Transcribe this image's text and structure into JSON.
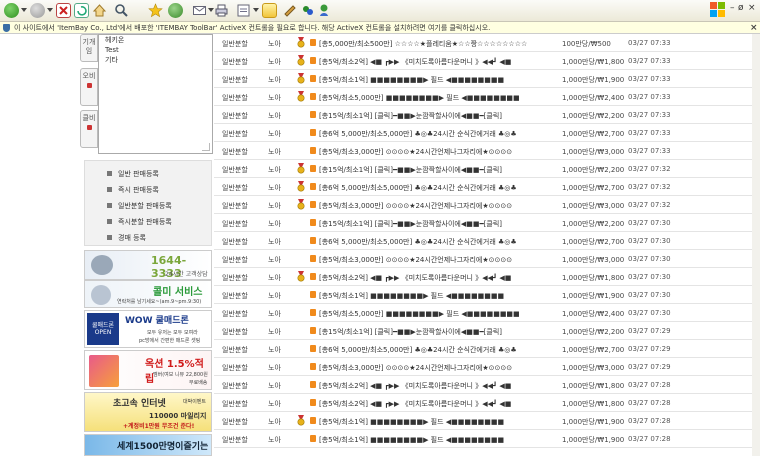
{
  "infobar": {
    "text": "이 사이트에서 'ItemBay Co., Ltd'에서 배포한 'ITEMBAY ToolBar' ActiveX 컨트롤을 필요로 합니다. 해당 ActiveX 컨트롤을 설치하려면 여기를 클릭하십시오.",
    "close": "×"
  },
  "window": {
    "minimize": "–",
    "restore": "ø",
    "close": "×"
  },
  "vtabs": [
    "기개임",
    "오비",
    "클비"
  ],
  "listbox_items": [
    "헤키온",
    "Test",
    "기타"
  ],
  "sale_menu": [
    "일반 판매등록",
    "즉시 판매등록",
    "일반분할 판매등록",
    "즉시분할 판매등록",
    "경매 등록"
  ],
  "banners": {
    "phone": {
      "number": "1644-3333",
      "sub": "24시간 고객상담"
    },
    "call": {
      "title": "콜미 서비스",
      "sub": "연락처를 남기세요~(am.9~pm.9:30)"
    },
    "wow": {
      "badge": "쿨매드론 OPEN",
      "title": "WOW 쿨매드론",
      "sub1": "모두 유저는 모두 모여라",
      "sub2": "pc방에서 간편한 매드론 셋팅"
    },
    "auction": {
      "title": "옥션 1.5%적립",
      "sub1": "멤버(여보 니뷰 22,800원",
      "sub2": "무료배송"
    },
    "internet": {
      "title": "초고속 인터넷",
      "tag": "대박이벤트",
      "sub1": "110000 마일리지",
      "sub2": "+계정비1만원 무조건 준다!"
    },
    "bottom": {
      "title": "세계1500만명이즐기는"
    }
  },
  "rows": [
    {
      "type": "일반분할",
      "server": "노아",
      "medal": true,
      "title": "[총5,000만/최소500만] ☆☆☆☆★플레티움★☆☆짱☆☆☆☆☆☆☆☆",
      "price": "100만당/₩500",
      "time": "03/27 07:33"
    },
    {
      "type": "일반분할",
      "server": "노아",
      "medal": true,
      "title": "[총5억/최소2억] ◀■ ┏▶▶ 《미치도록아름다운머니 》◀◀┛ ◀■",
      "price": "1,000만당/₩1,800",
      "time": "03/27 07:33"
    },
    {
      "type": "일반분할",
      "server": "노아",
      "medal": true,
      "title": "[총5억/최소1억] ■■■■■■■■▶ 필드 ◀■■■■■■■■",
      "price": "1,000만당/₩1,900",
      "time": "03/27 07:33"
    },
    {
      "type": "일반분할",
      "server": "노아",
      "medal": true,
      "title": "[총5억/최소5,000만] ■■■■■■■■▶ 필드 ◀■■■■■■■■",
      "price": "1,000만당/₩2,400",
      "time": "03/27 07:33"
    },
    {
      "type": "일반분할",
      "server": "노아",
      "medal": false,
      "title": "[총15억/최소1억] [클릭]━■■▶눈깜짝할사이에◀■■━[클릭]",
      "price": "1,000만당/₩2,200",
      "time": "03/27 07:33"
    },
    {
      "type": "일반분할",
      "server": "노아",
      "medal": false,
      "title": "[총6억 5,000만/최소5,000만] ♣◎♣24시간 순식간에거래 ♣◎♣",
      "price": "1,000만당/₩2,700",
      "time": "03/27 07:33"
    },
    {
      "type": "일반분할",
      "server": "노아",
      "medal": false,
      "title": "[총5억/최소3,000만] ⊙⊙⊙⊙★24시간언제나그자리에★⊙⊙⊙⊙",
      "price": "1,000만당/₩3,000",
      "time": "03/27 07:33"
    },
    {
      "type": "일반분할",
      "server": "노아",
      "medal": true,
      "title": "[총15억/최소1억] [클릭]━■■▶눈깜짝할사이에◀■■━[클릭]",
      "price": "1,000만당/₩2,200",
      "time": "03/27 07:32"
    },
    {
      "type": "일반분할",
      "server": "노아",
      "medal": true,
      "title": "[총6억 5,000만/최소5,000만] ♣◎♣24시간 순식간에거래 ♣◎♣",
      "price": "1,000만당/₩2,700",
      "time": "03/27 07:32"
    },
    {
      "type": "일반분할",
      "server": "노아",
      "medal": true,
      "title": "[총5억/최소3,000만] ⊙⊙⊙⊙★24시간언제나그자리에★⊙⊙⊙⊙",
      "price": "1,000만당/₩3,000",
      "time": "03/27 07:32"
    },
    {
      "type": "일반분할",
      "server": "노아",
      "medal": false,
      "title": "[총15억/최소1억] [클릭]━■■▶눈깜짝할사이에◀■■━[클릭]",
      "price": "1,000만당/₩2,200",
      "time": "03/27 07:30"
    },
    {
      "type": "일반분할",
      "server": "노아",
      "medal": false,
      "title": "[총6억 5,000만/최소5,000만] ♣◎♣24시간 순식간에거래 ♣◎♣",
      "price": "1,000만당/₩2,700",
      "time": "03/27 07:30"
    },
    {
      "type": "일반분할",
      "server": "노아",
      "medal": false,
      "title": "[총5억/최소3,000만] ⊙⊙⊙⊙★24시간언제나그자리에★⊙⊙⊙⊙",
      "price": "1,000만당/₩3,000",
      "time": "03/27 07:30"
    },
    {
      "type": "일반분할",
      "server": "노아",
      "medal": true,
      "title": "[총5억/최소2억] ◀■ ┏▶▶ 《미치도록아름다운머니 》◀◀┛ ◀■",
      "price": "1,000만당/₩1,800",
      "time": "03/27 07:30"
    },
    {
      "type": "일반분할",
      "server": "노아",
      "medal": false,
      "title": "[총5억/최소1억] ■■■■■■■■▶ 필드 ◀■■■■■■■■",
      "price": "1,000만당/₩1,900",
      "time": "03/27 07:30"
    },
    {
      "type": "일반분할",
      "server": "노아",
      "medal": false,
      "title": "[총5억/최소5,000만] ■■■■■■■■▶ 필드 ◀■■■■■■■■",
      "price": "1,000만당/₩2,400",
      "time": "03/27 07:30"
    },
    {
      "type": "일반분할",
      "server": "노아",
      "medal": false,
      "title": "[총15억/최소1억] [클릭]━■■▶눈깜짝할사이에◀■■━[클릭]",
      "price": "1,000만당/₩2,200",
      "time": "03/27 07:29"
    },
    {
      "type": "일반분할",
      "server": "노아",
      "medal": false,
      "title": "[총6억 5,000만/최소5,000만] ♣◎♣24시간 순식간에거래 ♣◎♣",
      "price": "1,000만당/₩2,700",
      "time": "03/27 07:29"
    },
    {
      "type": "일반분할",
      "server": "노아",
      "medal": false,
      "title": "[총5억/최소3,000만] ⊙⊙⊙⊙★24시간언제나그자리에★⊙⊙⊙⊙",
      "price": "1,000만당/₩3,000",
      "time": "03/27 07:29"
    },
    {
      "type": "일반분할",
      "server": "노아",
      "medal": false,
      "title": "[총5억/최소2억] ◀■ ┏▶▶ 《미치도록아름다운머니 》◀◀┛ ◀■",
      "price": "1,000만당/₩1,800",
      "time": "03/27 07:28"
    },
    {
      "type": "일반분할",
      "server": "노아",
      "medal": false,
      "title": "[총5억/최소2억] ◀■ ┏▶▶ 《미치도록아름다운머니 》◀◀┛ ◀■",
      "price": "1,000만당/₩1,800",
      "time": "03/27 07:28"
    },
    {
      "type": "일반분할",
      "server": "노아",
      "medal": true,
      "title": "[총5억/최소1억] ■■■■■■■■▶ 필드 ◀■■■■■■■■",
      "price": "1,000만당/₩1,900",
      "time": "03/27 07:28"
    },
    {
      "type": "일반분할",
      "server": "노아",
      "medal": false,
      "title": "[총5억/최소1억] ■■■■■■■■▶ 필드 ◀■■■■■■■■",
      "price": "1,000만당/₩1,900",
      "time": "03/27 07:28"
    }
  ],
  "icons": {
    "toolbar": [
      "back-icon",
      "forward-icon",
      "stop-icon",
      "refresh-icon",
      "home-icon",
      "search-icon",
      "favorites-icon",
      "history-icon",
      "mail-icon",
      "print-icon",
      "edit-icon",
      "discuss-icon",
      "folder-icon",
      "messenger-icon",
      "research-icon",
      "tools-icon"
    ],
    "row_medal": "gold-medal-icon",
    "row_type": "split-sale-icon"
  },
  "colors": {
    "accent": "#f08a1c",
    "infobar": "#ffffe1",
    "medal": "#e8b21a"
  }
}
